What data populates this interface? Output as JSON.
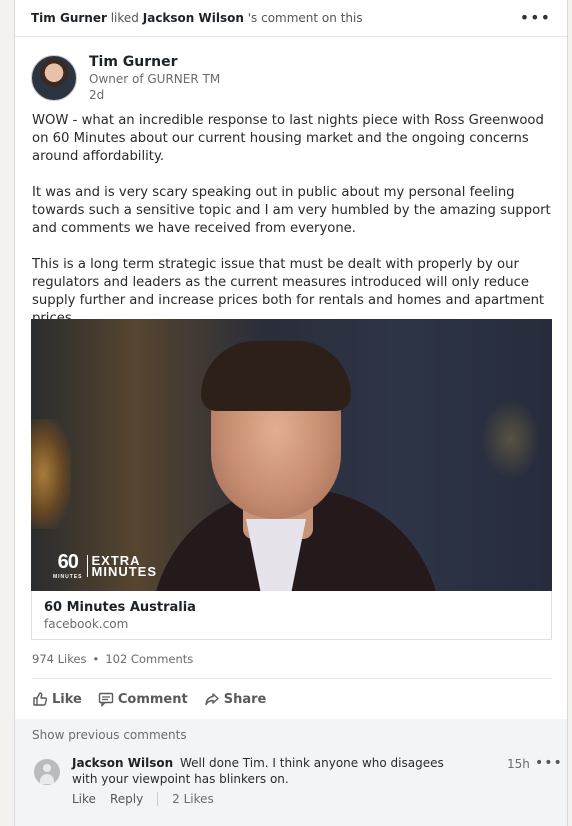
{
  "activity": {
    "actor": "Tim Gurner",
    "verb": "liked",
    "target": "Jackson Wilson",
    "suffix": "'s comment on this"
  },
  "post": {
    "author_name": "Tim Gurner",
    "author_headline": "Owner of GURNER TM",
    "time": "2d",
    "paragraphs": [
      "WOW - what an incredible response to last nights piece with Ross Greenwood on 60 Minutes about our current housing market and the ongoing concerns around affordability.",
      "It was and is very scary speaking out in public about my personal feeling towards such a sensitive topic and I am very humbled by the amazing support and comments we have received from everyone.",
      "This is a long term strategic issue that must be dealt with properly by our regulators and leaders as the current measures introduced will only reduce supply further and increase prices both for rentals and homes and apartment prices."
    ]
  },
  "media": {
    "logo_sixty": "60",
    "logo_minutes": "MINUTES",
    "logo_extra": "EXTRA",
    "logo_extra_minutes": "MINUTES"
  },
  "link_card": {
    "title": "60 Minutes Australia",
    "domain": "facebook.com"
  },
  "stats": {
    "likes": "974 Likes",
    "dot": "•",
    "comments": "102 Comments"
  },
  "actions": {
    "like": "Like",
    "comment": "Comment",
    "share": "Share"
  },
  "comments": {
    "show_previous": "Show previous comments",
    "items": [
      {
        "author": "Jackson Wilson",
        "text": "Well done Tim. I think anyone who disagees with your viewpoint has blinkers on.",
        "time": "15h",
        "like": "Like",
        "reply": "Reply",
        "likes": "2 Likes"
      }
    ]
  },
  "icons": {
    "more": "more-icon",
    "like": "thumbs-up-icon",
    "comment": "comment-icon",
    "share": "share-icon",
    "avatar_placeholder": "person-icon"
  }
}
